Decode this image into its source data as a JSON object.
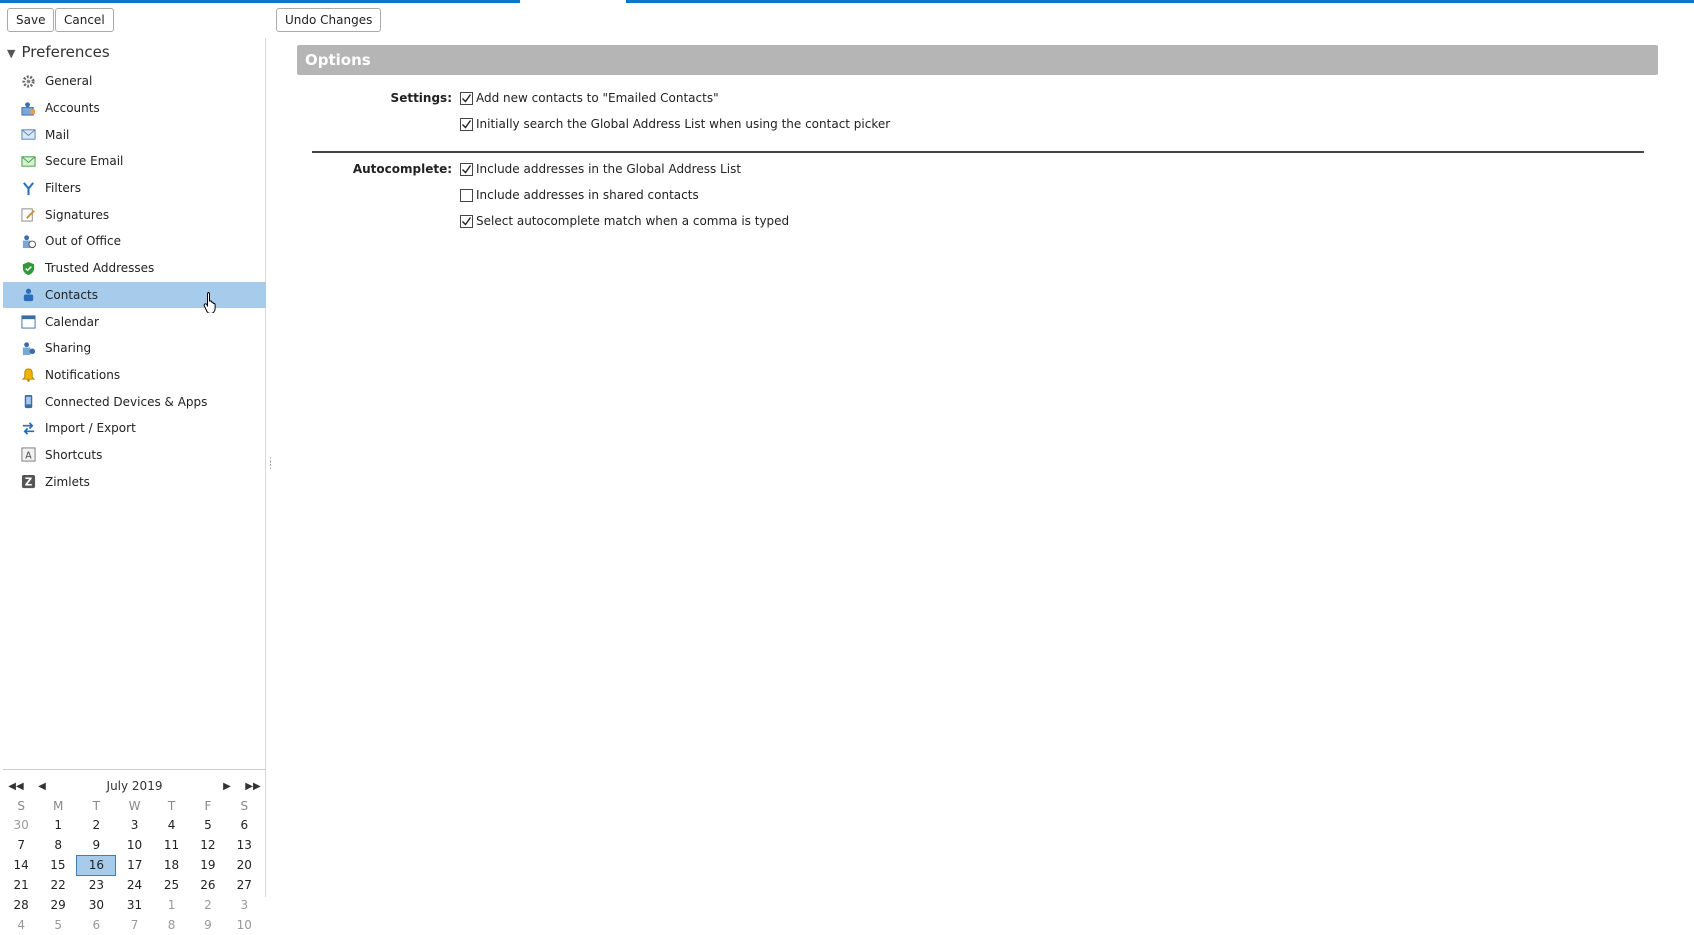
{
  "toolbar": {
    "save_label": "Save",
    "cancel_label": "Cancel",
    "undo_label": "Undo Changes"
  },
  "colors": {
    "accent": "#0b77c9",
    "selected_bg": "#a7cceb",
    "section_header_bg": "#b5b5b5"
  },
  "sidebar": {
    "title": "Preferences",
    "items": [
      {
        "label": "General",
        "icon": "gear-icon"
      },
      {
        "label": "Accounts",
        "icon": "accounts-icon"
      },
      {
        "label": "Mail",
        "icon": "mail-icon"
      },
      {
        "label": "Secure Email",
        "icon": "secure-email-icon"
      },
      {
        "label": "Filters",
        "icon": "filter-icon"
      },
      {
        "label": "Signatures",
        "icon": "signature-icon"
      },
      {
        "label": "Out of Office",
        "icon": "out-of-office-icon"
      },
      {
        "label": "Trusted Addresses",
        "icon": "shield-icon"
      },
      {
        "label": "Contacts",
        "icon": "contacts-icon",
        "selected": true
      },
      {
        "label": "Calendar",
        "icon": "calendar-icon"
      },
      {
        "label": "Sharing",
        "icon": "sharing-icon"
      },
      {
        "label": "Notifications",
        "icon": "bell-icon"
      },
      {
        "label": "Connected Devices & Apps",
        "icon": "device-icon"
      },
      {
        "label": "Import / Export",
        "icon": "import-export-icon"
      },
      {
        "label": "Shortcuts",
        "icon": "keyboard-shortcut-icon"
      },
      {
        "label": "Zimlets",
        "icon": "zimlet-icon"
      }
    ]
  },
  "mini_calendar": {
    "title": "July 2019",
    "weekdays": [
      "S",
      "M",
      "T",
      "W",
      "T",
      "F",
      "S"
    ],
    "weeks": [
      [
        {
          "d": "30",
          "o": true
        },
        {
          "d": "1"
        },
        {
          "d": "2"
        },
        {
          "d": "3"
        },
        {
          "d": "4"
        },
        {
          "d": "5"
        },
        {
          "d": "6"
        }
      ],
      [
        {
          "d": "7"
        },
        {
          "d": "8"
        },
        {
          "d": "9"
        },
        {
          "d": "10"
        },
        {
          "d": "11"
        },
        {
          "d": "12"
        },
        {
          "d": "13"
        }
      ],
      [
        {
          "d": "14"
        },
        {
          "d": "15"
        },
        {
          "d": "16",
          "today": true
        },
        {
          "d": "17"
        },
        {
          "d": "18"
        },
        {
          "d": "19"
        },
        {
          "d": "20"
        }
      ],
      [
        {
          "d": "21"
        },
        {
          "d": "22"
        },
        {
          "d": "23"
        },
        {
          "d": "24"
        },
        {
          "d": "25"
        },
        {
          "d": "26"
        },
        {
          "d": "27"
        }
      ],
      [
        {
          "d": "28"
        },
        {
          "d": "29"
        },
        {
          "d": "30"
        },
        {
          "d": "31"
        },
        {
          "d": "1",
          "o": true
        },
        {
          "d": "2",
          "o": true
        },
        {
          "d": "3",
          "o": true
        }
      ],
      [
        {
          "d": "4",
          "o": true
        },
        {
          "d": "5",
          "o": true
        },
        {
          "d": "6",
          "o": true
        },
        {
          "d": "7",
          "o": true
        },
        {
          "d": "8",
          "o": true
        },
        {
          "d": "9",
          "o": true
        },
        {
          "d": "10",
          "o": true
        }
      ]
    ]
  },
  "main": {
    "section_title": "Options",
    "settings_label": "Settings:",
    "autocomplete_label": "Autocomplete:",
    "settings": [
      {
        "label": "Add new contacts to \"Emailed Contacts\"",
        "checked": true
      },
      {
        "label": "Initially search the Global Address List when using the contact picker",
        "checked": true
      }
    ],
    "autocomplete": [
      {
        "label": "Include addresses in the Global Address List",
        "checked": true
      },
      {
        "label": "Include addresses in shared contacts",
        "checked": false
      },
      {
        "label": "Select autocomplete match when a comma is typed",
        "checked": true
      }
    ]
  }
}
